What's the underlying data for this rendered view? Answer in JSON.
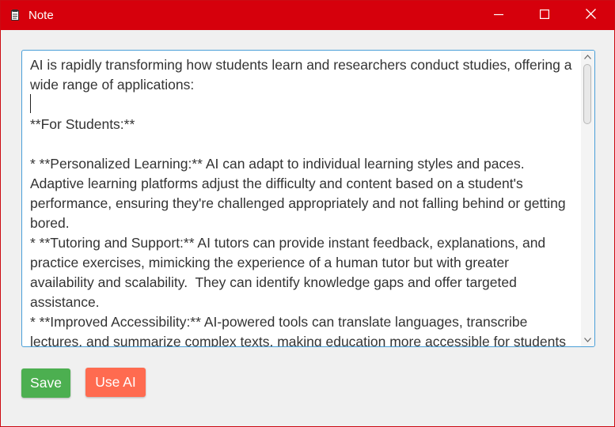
{
  "window": {
    "title": "Note",
    "icon": "notepad-icon",
    "accent_color": "#d6000c",
    "controls": {
      "minimize": "minimize-icon",
      "maximize": "maximize-icon",
      "close": "close-icon"
    }
  },
  "editor": {
    "content": "AI is rapidly transforming how students learn and researchers conduct studies, offering a wide range of applications:\n\n**For Students:**\n\n* **Personalized Learning:** AI can adapt to individual learning styles and paces.  Adaptive learning platforms adjust the difficulty and content based on a student's performance, ensuring they're challenged appropriately and not falling behind or getting bored.\n* **Tutoring and Support:** AI tutors can provide instant feedback, explanations, and practice exercises, mimicking the experience of a human tutor but with greater availability and scalability.  They can identify knowledge gaps and offer targeted assistance.\n* **Improved Accessibility:** AI-powered tools can translate languages, transcribe lectures, and summarize complex texts, making education more accessible for students",
    "border_color": "#4a9fd8"
  },
  "buttons": {
    "save_label": "Save",
    "save_color": "#4caf50",
    "use_ai_label": "Use AI",
    "use_ai_color": "#ff6b50"
  }
}
